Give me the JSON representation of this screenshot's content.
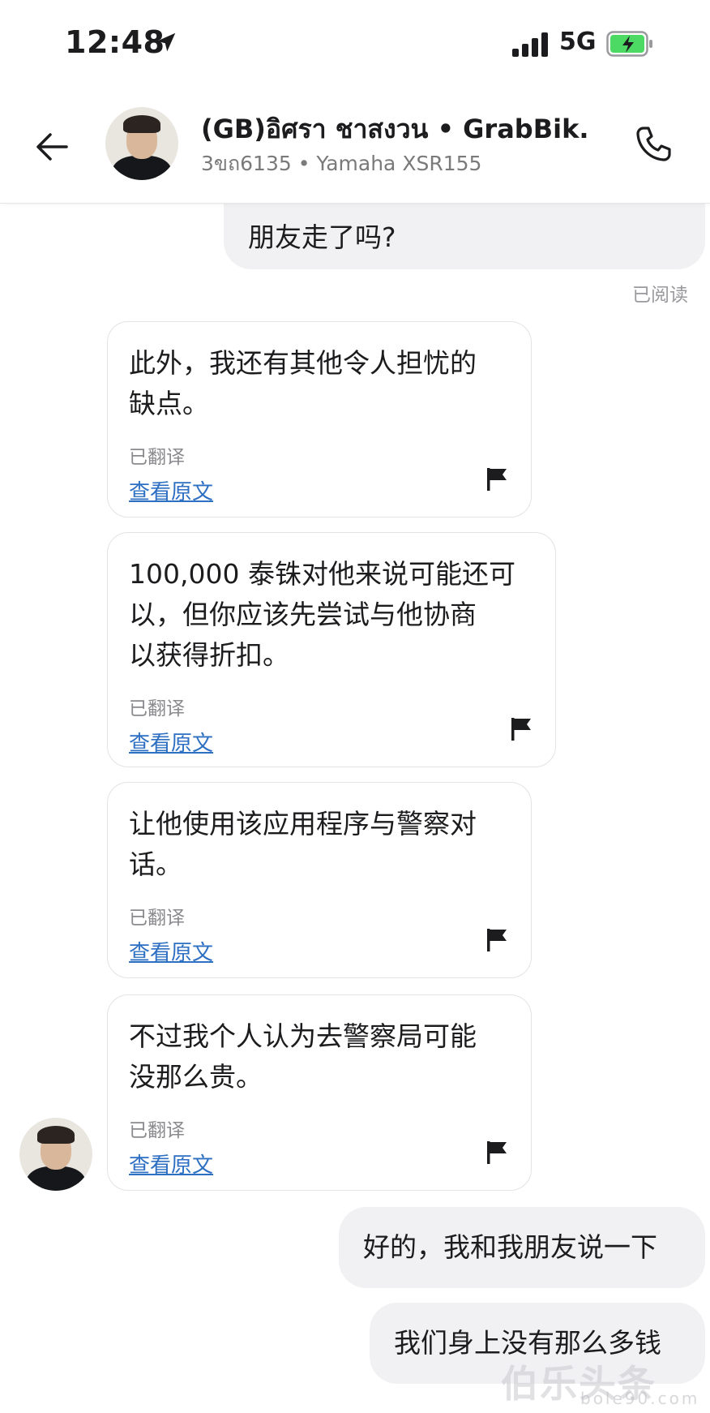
{
  "status": {
    "time": "12:48",
    "network": "5G"
  },
  "header": {
    "name": "(GB)อิศรา ชาสงวน • GrabBik...",
    "sub": "3ขถ6135 • Yamaha XSR155"
  },
  "messages": {
    "out1": "朋友走了吗?",
    "read_label": "已阅读",
    "in1": "此外，我还有其他令人担忧的\n缺点。",
    "in2": "100,000 泰铢对他来说可能还可\n以，但你应该先尝试与他协商\n以获得折扣。",
    "in3": "让他使用该应用程序与警察对\n话。",
    "in4": "不过我个人认为去警察局可能\n没那么贵。",
    "translated_label": "已翻译",
    "view_original": "查看原文",
    "out2": "好的，我和我朋友说一下",
    "out3": "我们身上没有那么多钱"
  },
  "watermark": {
    "main": "伯乐头条",
    "sub": "bole90.com"
  },
  "icons": {
    "back": "arrow-left",
    "call": "phone",
    "report": "flag",
    "location": "location-arrow"
  },
  "colors": {
    "link": "#2d6fc2",
    "battery": "#4cd964",
    "outgoing_bubble": "#f1f1f3"
  }
}
